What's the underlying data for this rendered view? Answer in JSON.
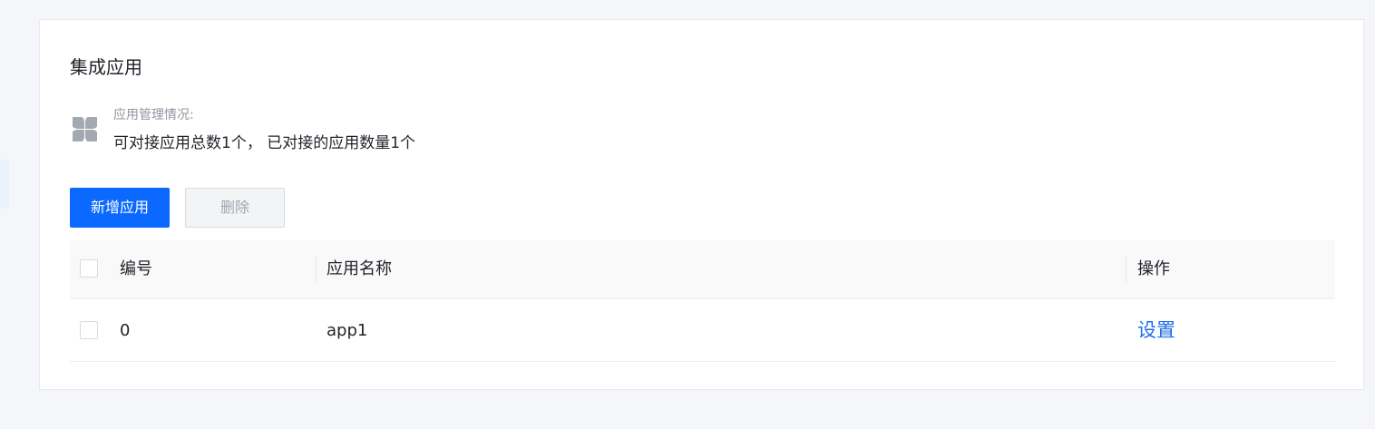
{
  "page": {
    "title": "集成应用"
  },
  "summary": {
    "label": "应用管理情况:",
    "text": "可对接应用总数1个， 已对接的应用数量1个",
    "icon": "app-grid-icon"
  },
  "toolbar": {
    "add_label": "新增应用",
    "delete_label": "删除"
  },
  "table": {
    "columns": [
      "编号",
      "应用名称",
      "操作"
    ],
    "rows": [
      {
        "id": "0",
        "name": "app1",
        "action": "设置"
      }
    ]
  },
  "colors": {
    "primary": "#0b69ff",
    "link": "#1e6fe6",
    "background": "#f5f6fa"
  }
}
